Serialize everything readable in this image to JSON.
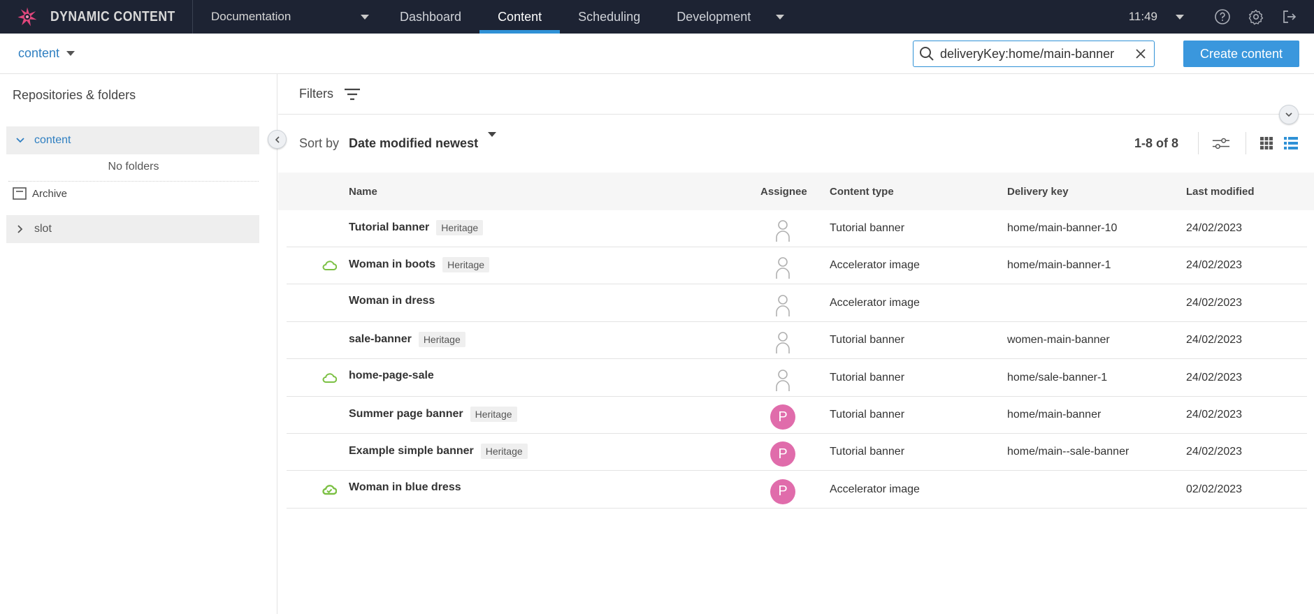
{
  "app": {
    "brand": "DYNAMIC CONTENT",
    "hub": "Documentation",
    "time": "11:49"
  },
  "nav": {
    "items": [
      "Dashboard",
      "Content",
      "Scheduling",
      "Development"
    ],
    "active": "Content"
  },
  "subbar": {
    "repository": "content",
    "search_value": "deliveryKey:home/main-banner",
    "create_label": "Create content"
  },
  "sidebar": {
    "title": "Repositories & folders",
    "tree": [
      {
        "label": "content",
        "expanded": true
      },
      {
        "label": "slot",
        "expanded": false
      }
    ],
    "no_folders": "No folders",
    "archive": "Archive"
  },
  "filters": {
    "label": "Filters"
  },
  "sort": {
    "label": "Sort by",
    "value": "Date modified newest",
    "count": "1-8 of 8"
  },
  "table": {
    "columns": {
      "name": "Name",
      "assignee": "Assignee",
      "type": "Content type",
      "key": "Delivery key",
      "modified": "Last modified"
    },
    "rows": [
      {
        "name": "Tutorial banner",
        "badge": "Heritage",
        "cloud": "none",
        "assignee": "",
        "type": "Tutorial banner",
        "key": "home/main-banner-10",
        "modified": "24/02/2023"
      },
      {
        "name": "Woman in boots",
        "badge": "Heritage",
        "cloud": "outline",
        "assignee": "",
        "type": "Accelerator image",
        "key": "home/main-banner-1",
        "modified": "24/02/2023"
      },
      {
        "name": "Woman in dress",
        "badge": "",
        "cloud": "none",
        "assignee": "",
        "type": "Accelerator image",
        "key": "",
        "modified": "24/02/2023"
      },
      {
        "name": "sale-banner",
        "badge": "Heritage",
        "cloud": "none",
        "assignee": "",
        "type": "Tutorial banner",
        "key": "women-main-banner",
        "modified": "24/02/2023"
      },
      {
        "name": "home-page-sale",
        "badge": "",
        "cloud": "outline",
        "assignee": "",
        "type": "Tutorial banner",
        "key": "home/sale-banner-1",
        "modified": "24/02/2023"
      },
      {
        "name": "Summer page banner",
        "badge": "Heritage",
        "cloud": "none",
        "assignee": "P",
        "type": "Tutorial banner",
        "key": "home/main-banner",
        "modified": "24/02/2023"
      },
      {
        "name": "Example simple banner",
        "badge": "Heritage",
        "cloud": "none",
        "assignee": "P",
        "type": "Tutorial banner",
        "key": "home/main--sale-banner",
        "modified": "24/02/2023"
      },
      {
        "name": "Woman in blue dress",
        "badge": "",
        "cloud": "check",
        "assignee": "P",
        "type": "Accelerator image",
        "key": "",
        "modified": "02/02/2023"
      }
    ]
  },
  "colors": {
    "topbar": "#1d2333",
    "accent": "#2f91d6",
    "publish_green": "#7bc043",
    "avatar": "#e06cab"
  }
}
